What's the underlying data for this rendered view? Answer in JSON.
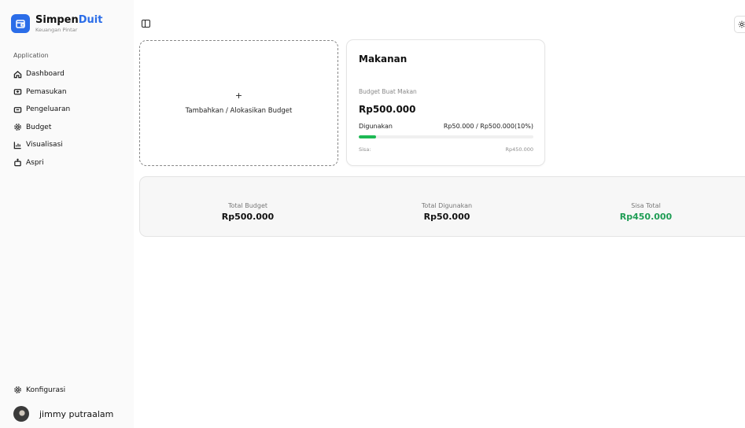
{
  "brand": {
    "name_part1": "Simpen",
    "name_part2": "Duit",
    "tagline": "Keuangan Pintar",
    "accent": "#2b6de8"
  },
  "sidebar": {
    "section_label": "Application",
    "items": [
      {
        "label": "Dashboard",
        "icon": "home-icon"
      },
      {
        "label": "Pemasukan",
        "icon": "wallet-in-icon"
      },
      {
        "label": "Pengeluaran",
        "icon": "wallet-out-icon"
      },
      {
        "label": "Budget",
        "icon": "gear-icon"
      },
      {
        "label": "Visualisasi",
        "icon": "chart-icon"
      },
      {
        "label": "Aspri",
        "icon": "bot-icon"
      }
    ],
    "settings_label": "Konfigurasi",
    "user_name": "jimmy putraalam"
  },
  "main": {
    "add_card": {
      "plus": "+",
      "label": "Tambahkan / Alokasikan Budget"
    },
    "budget_card": {
      "title": "Makanan",
      "description": "Budget Buat Makan",
      "amount": "Rp500.000",
      "used_label": "Digunakan",
      "used_value": "Rp50.000 / Rp500.000(10%)",
      "progress": 0.1,
      "progress_color": "#1db954",
      "remaining_label": "Sisa:",
      "remaining_value": "Rp450.000"
    },
    "summary": {
      "total_budget_label": "Total Budget",
      "total_budget_value": "Rp500.000",
      "total_used_label": "Total Digunakan",
      "total_used_value": "Rp50.000",
      "remaining_label": "Sisa Total",
      "remaining_value": "Rp450.000",
      "remaining_color": "#1f9d55"
    }
  }
}
